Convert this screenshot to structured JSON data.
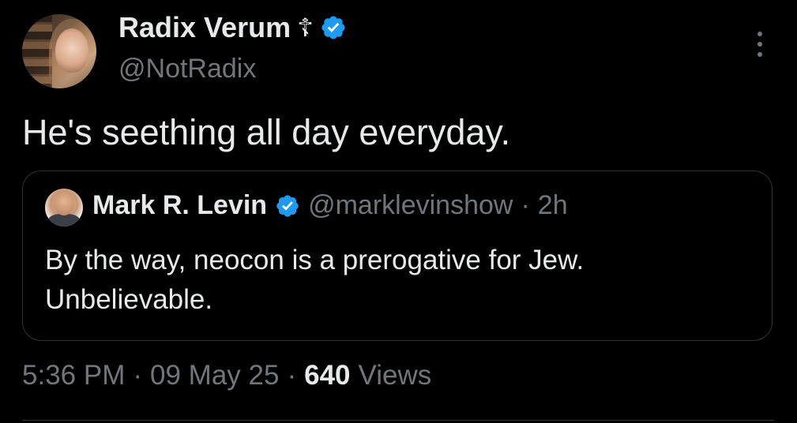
{
  "tweet": {
    "author": {
      "display_name": "Radix Verum",
      "name_symbol": "☦",
      "handle": "@NotRadix",
      "verified": true
    },
    "text": "He's seething all day everyday.",
    "quoted": {
      "display_name": "Mark R. Levin",
      "handle": "@marklevinshow",
      "separator": "·",
      "time": "2h",
      "verified": true,
      "text_line1": "By the way, neocon is a prerogative for Jew.",
      "text_line2": "Unbelievable."
    },
    "meta": {
      "time": "5:36 PM",
      "separator": "·",
      "date": "09 May 25",
      "views_count": "640",
      "views_label": "Views"
    }
  },
  "icons": {
    "verified": "verified-badge-icon",
    "more": "more-options-icon"
  },
  "colors": {
    "background": "#000000",
    "primary_text": "#e7e9ea",
    "secondary_text": "#71767b",
    "verified_blue": "#1d9bf0",
    "border": "#2f3336"
  }
}
